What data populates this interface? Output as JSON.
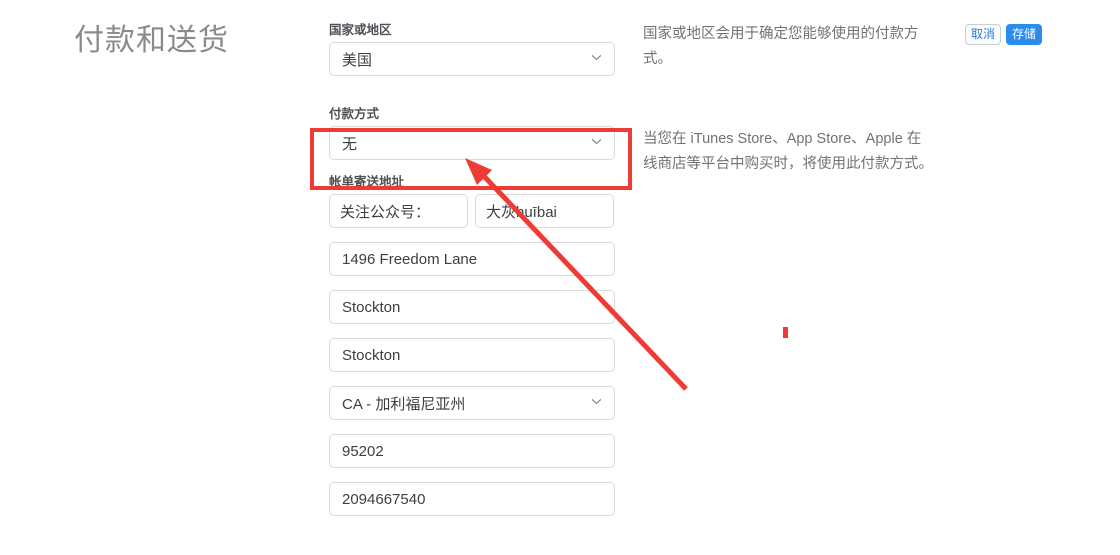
{
  "page": {
    "title": "付款和送货"
  },
  "toolbar": {
    "cancel_label": "取消",
    "save_label": "存储"
  },
  "form": {
    "country": {
      "label": "国家或地区",
      "value": "美国",
      "icon": "chevron-down-icon"
    },
    "payment_method": {
      "label": "付款方式",
      "value": "无",
      "icon": "chevron-down-icon"
    },
    "billing_address": {
      "label": "帐单寄送地址",
      "first_name": "关注公众号：",
      "last_name": "大灰huībai",
      "street": "1496 Freedom Lane",
      "city": "Stockton",
      "district": "Stockton",
      "state": "CA - 加利福尼亚州",
      "state_icon": "chevron-down-icon",
      "postal_code": "95202",
      "phone": "2094667540"
    }
  },
  "help": {
    "country": "国家或地区会用于确定您能够使用的付款方式。",
    "payment_method": "当您在 iTunes Store、App Store、Apple 在线商店等平台中购买时，将使用此付款方式。"
  },
  "annotations": {
    "highlight_color": "#ef3b36",
    "arrow_color": "#ef3b36",
    "arrow_target": "payment-method-select",
    "arrow_tip": "467,160",
    "arrow_tail": "686,389"
  },
  "colors": {
    "accent_blue": "#2b8ceb",
    "annotation_red": "#ef3b36",
    "title_gray": "#888b8e",
    "border_gray": "#d9d9d9"
  }
}
